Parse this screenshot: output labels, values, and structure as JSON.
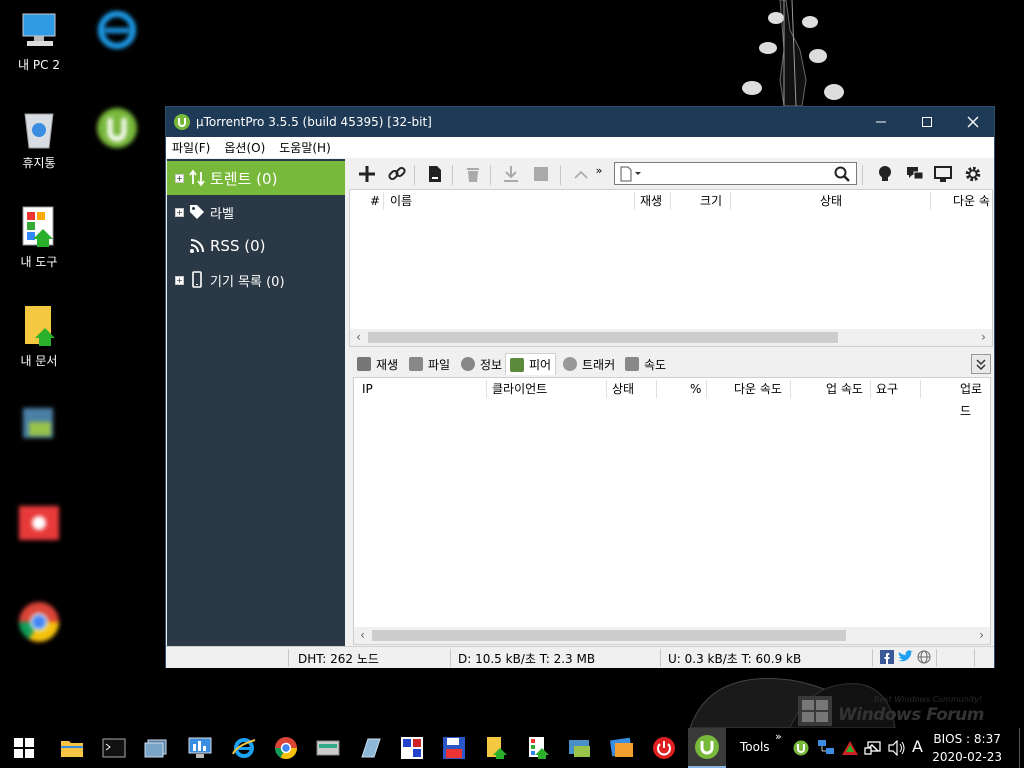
{
  "desktop": {
    "icons": [
      {
        "label": "내 PC 2"
      },
      {
        "label": "휴지통"
      },
      {
        "label": "내 도구"
      },
      {
        "label": "내 문서"
      }
    ]
  },
  "window": {
    "title": "µTorrentPro 3.5.5  (build 45395) [32-bit]",
    "menu": [
      "파일(F)",
      "옵션(O)",
      "도움말(H)"
    ]
  },
  "sidebar": {
    "items": [
      {
        "label": "토렌트 (0)"
      },
      {
        "label": "라벨"
      },
      {
        "label": "RSS (0)"
      },
      {
        "label": "기기 목록 (0)"
      }
    ]
  },
  "torrent_list": {
    "columns": [
      "#",
      "이름",
      "재생",
      "크기",
      "상태",
      "다운 속"
    ]
  },
  "detail_tabs": [
    "재생",
    "파일",
    "정보",
    "피어",
    "트래커",
    "속도"
  ],
  "peer_list": {
    "columns": [
      "IP",
      "클라이언트",
      "상태",
      "%",
      "다운 속도",
      "업 속도",
      "요구",
      "업로드"
    ]
  },
  "statusbar": {
    "dht": "DHT: 262 노드",
    "download": "D: 10.5 kB/초 T: 2.3 MB",
    "upload": "U: 0.3 kB/초 T: 60.9 kB"
  },
  "taskbar": {
    "tools_label": "Tools",
    "overflow": "»",
    "ime": "A",
    "clock_time": "BIOS : 8:37",
    "clock_date": "2020-02-23"
  },
  "colors": {
    "titlebar": "#1f3a56",
    "sidebar": "#2b3846",
    "sidebar_selected": "#78b83a"
  }
}
